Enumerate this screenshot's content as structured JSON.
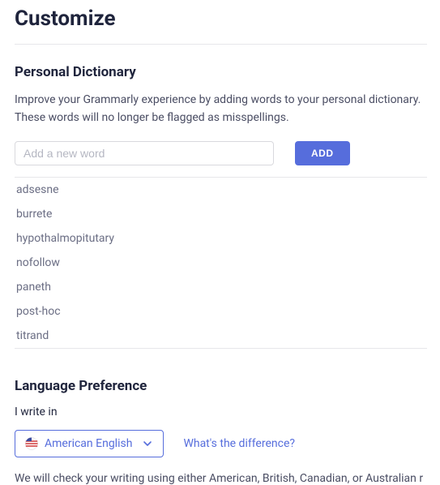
{
  "page": {
    "title": "Customize"
  },
  "dictionary": {
    "heading": "Personal Dictionary",
    "description": "Improve your Grammarly experience by adding words to your personal dictionary. These words will no longer be flagged as misspellings.",
    "input_placeholder": "Add a new word",
    "add_button": "ADD",
    "words": [
      "adsesne",
      "burrete",
      "hypothalmopitutary",
      "nofollow",
      "paneth",
      "post-hoc",
      "titrand"
    ]
  },
  "language": {
    "heading": "Language Preference",
    "subheading": "I write in",
    "selected": "American English",
    "difference_link": "What's the difference?",
    "footer": "We will check your writing using either American, British, Canadian, or Australian r"
  },
  "colors": {
    "accent": "#566ddc",
    "text_primary": "#1f243c",
    "text_muted": "#6b6e84",
    "border": "#e7e7ea"
  }
}
